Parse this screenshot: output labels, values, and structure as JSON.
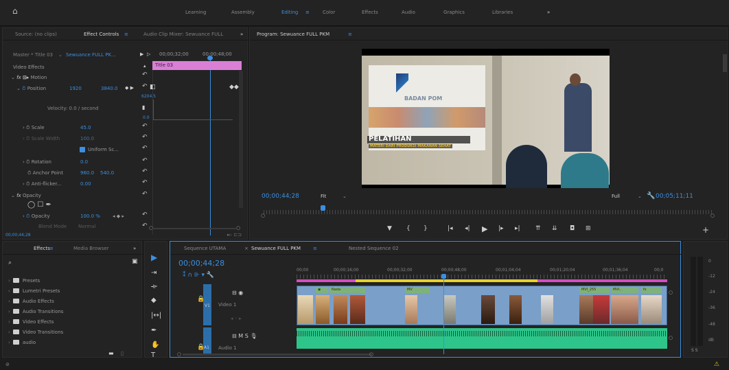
{
  "workspaces": [
    "Learning",
    "Assembly",
    "Editing",
    "Color",
    "Effects",
    "Audio",
    "Graphics",
    "Libraries"
  ],
  "workspace_active": "Editing",
  "workspace_more": "»",
  "source_panel": {
    "tabs": [
      "Source: (no clips)",
      "Effect Controls",
      "Audio Clip Mixer: Sewuance FULL"
    ],
    "more": "»",
    "master_label": "Master * Title 03",
    "sequence_link": "Sewuance FULL PK...",
    "tc_start": "00;00;32;00",
    "tc_end": "00;00;48;00",
    "clip_name": "Title 03",
    "section": "Video Effects",
    "fx_motion": "Motion",
    "position_label": "Position",
    "position_x": "1920",
    "position_y": "3840.0",
    "keyframe_value": "6204.5",
    "velocity": "Velocity: 0.0 / second",
    "zero_label": "0.0",
    "scale_label": "Scale",
    "scale_value": "45.0",
    "scale_width_label": "Scale Width",
    "scale_width_value": "100.0",
    "uniform_label": "Uniform Sc...",
    "rotation_label": "Rotation",
    "rotation_value": "0.0",
    "anchor_label": "Anchor Point",
    "anchor_x": "960.0",
    "anchor_y": "540.0",
    "antiflicker_label": "Anti-flicker...",
    "antiflicker_value": "0.00",
    "opacity_label": "Opacity",
    "opacity_row_label": "Opacity",
    "opacity_value": "100.0 %",
    "blend_label": "Blend Mode",
    "blend_value": "Normal",
    "timecode": "00;00;44;28"
  },
  "program": {
    "title": "Program: Sewuance FULL PKM",
    "timecode": "00;00;44;28",
    "fit": "Fit",
    "full": "Full",
    "duration": "00;05;11;11",
    "slide_logo": "BADAN POM",
    "lower_third_title": "PELATIHAN",
    "lower_third_sub": "MATERI DARI PRODUKSI MAKANAN SEHAT"
  },
  "effects_panel": {
    "tabs": [
      "Effects",
      "Media Browser"
    ],
    "more": "»",
    "search_placeholder": "",
    "bins": [
      "Presets",
      "Lumetri Presets",
      "Audio Effects",
      "Audio Transitions",
      "Video Effects",
      "Video Transitions",
      "audio"
    ]
  },
  "timeline": {
    "tabs": [
      "Sequence UTAMA",
      "Sewuance FULL PKM",
      "Nested Sequence 02"
    ],
    "timecode": "00;00;44;28",
    "ruler": [
      "00;00",
      "00;00;16;00",
      "00;00;32;00",
      "00;00;48;00",
      "00;01;04;04",
      "00;01;20;04",
      "00;01;36;04",
      "00;0"
    ],
    "v1_label": "V1",
    "v1_name": "Video 1",
    "a1_label": "A1",
    "a1_name": "Audio 1",
    "audio_meter_labels": [
      "0",
      "-12",
      "-24",
      "-36",
      "-48",
      "dB"
    ],
    "meter_solo": "S S",
    "clip_labels": [
      "fx",
      "Nada",
      "MV",
      "MVI_255",
      "MVI..",
      "fx"
    ]
  },
  "colors": {
    "accent": "#3b8fe0",
    "pink": "#e050c8",
    "clip_blue": "#6f9ccc",
    "clip_green": "#7fb27a",
    "audio_green": "#2ec58a"
  }
}
